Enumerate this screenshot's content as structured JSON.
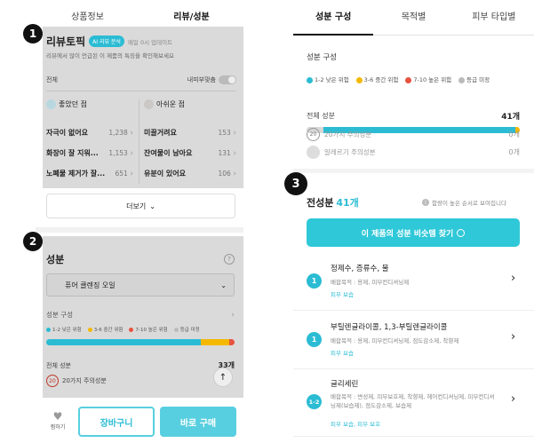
{
  "left": {
    "tabs": [
      "상품정보",
      "리뷰/성분"
    ],
    "badges": [
      "1",
      "2"
    ],
    "review_topic": {
      "title": "리뷰토픽",
      "ai_tag": "AI 리뷰 분석",
      "update_note": "매일 0시 업데이트",
      "subtitle": "리뷰에서 많이 언급된 이 제품의 특징을 확인해보세요",
      "filter_all": "전체",
      "skin_match_label": "내피부맞춤",
      "good_label": "좋았던 점",
      "bad_label": "아쉬운 점",
      "good_items": [
        {
          "label": "자극이 없어요",
          "count": "1,238"
        },
        {
          "label": "화장이 잘 지워...",
          "count": "1,153"
        },
        {
          "label": "노폐물 제거가 잘...",
          "count": "651"
        }
      ],
      "bad_items": [
        {
          "label": "미끌거려요",
          "count": "153"
        },
        {
          "label": "잔여물이 남아요",
          "count": "131"
        },
        {
          "label": "유분이 있어요",
          "count": "106"
        }
      ],
      "more_button": "더보기"
    },
    "ingredients": {
      "title": "성분",
      "help_icon": "?",
      "product_select": "퓨어 클렌징 오일",
      "composition_label": "성분 구성",
      "legend": [
        {
          "label": "1-2 낮은 위험",
          "color": "#2bbcd4"
        },
        {
          "label": "3-6 중간 위험",
          "color": "#f5b800"
        },
        {
          "label": "7-10 높은 위험",
          "color": "#e8523f"
        },
        {
          "label": "등급 미정",
          "color": "#bbbbbb"
        }
      ],
      "total_label": "전체 성분",
      "total_count": "33개",
      "caution_label": "20가지 주의성분",
      "caution_icon_text": "20"
    },
    "bottom_bar": {
      "wish_label": "찜하기",
      "cart_label": "장바구니",
      "buy_label": "바로 구매"
    }
  },
  "right": {
    "tabs": [
      "성분 구성",
      "목적별",
      "피부 타입별"
    ],
    "badge": "3",
    "composition": {
      "title": "성분 구성",
      "legend": [
        {
          "label": "1-2 낮은 위험",
          "color": "#2bbcd4"
        },
        {
          "label": "3-6 중간 위험",
          "color": "#f5b800"
        },
        {
          "label": "7-10 높은 위험",
          "color": "#e8523f"
        },
        {
          "label": "등급 미정",
          "color": "#bbbbbb"
        }
      ],
      "total_label": "전체 성분",
      "total_count": "41개",
      "caution_label": "20가지 주의성분",
      "caution_count": "0개",
      "caution_icon_text": "20",
      "allergy_label": "알레르기 주의성분",
      "allergy_count": "0개"
    },
    "full_ingredients": {
      "title": "전성분",
      "count": "41개",
      "note": "함량이 높은 순서로 보여집니다",
      "find_button": "이 제품의 성분 비슷템 찾기",
      "items": [
        {
          "grade": "1",
          "name": "정제수, 증류수, 물",
          "purpose": "배합목적 : 용제, 피부컨디셔닝제",
          "tags": "피부 보습"
        },
        {
          "grade": "1",
          "name": "부틸렌글라이콜, 1,3-부틸렌글라이콜",
          "purpose": "배합목적 : 용제, 피부컨디셔닝제, 점도감소제, 착향제",
          "tags": "피부 보습"
        },
        {
          "grade": "1-2",
          "name": "글리세린",
          "purpose": "배합목적 : 변성제, 피부보호제, 착향제, 헤어컨디셔닝제, 피부컨디셔닝제(보습제), 점도감소제, 보습제",
          "tags": "피부 보습, 피부 보호"
        }
      ]
    }
  }
}
